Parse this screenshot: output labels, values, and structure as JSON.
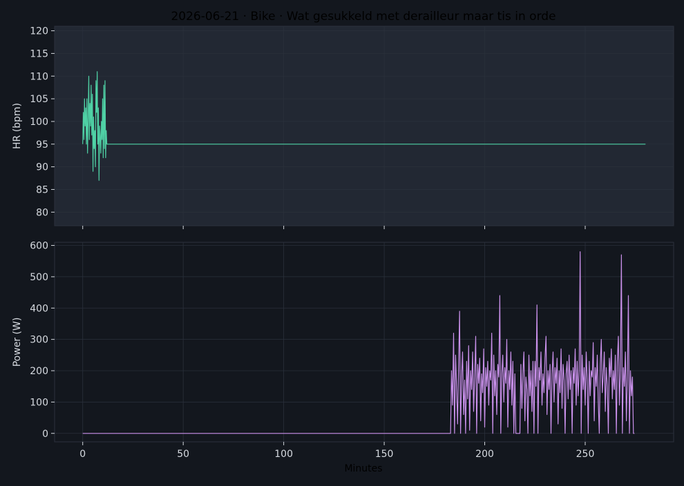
{
  "colors": {
    "background": "#13171e",
    "panel_top": "#222833",
    "panel_bottom": "#13171e",
    "panel_border": "#2c323d",
    "grid": "#2a303b",
    "text": "#d6dae0",
    "hr_line": "#4fd1a5",
    "power_line": "#c990ea"
  },
  "chart_data": {
    "type": "line",
    "title": "2026-06-21 · Bike · Wat gesukkeld met derailleur maar tis in orde",
    "xlabel": "Minutes",
    "x_ticks": [
      0,
      50,
      100,
      150,
      200,
      250
    ],
    "xlim": [
      -14,
      294
    ],
    "grid": true,
    "panels": [
      {
        "name": "hr",
        "ylabel": "HR (bpm)",
        "ylim": [
          77,
          121
        ],
        "y_ticks": [
          80,
          85,
          90,
          95,
          100,
          105,
          110,
          115,
          120
        ],
        "series": [
          {
            "x": [
              0,
              0.3,
              0.6,
              0.9,
              1.2,
              1.5,
              1.8,
              2.1,
              2.4,
              2.7,
              3.0,
              3.3,
              3.6,
              3.9,
              4.2,
              4.5,
              4.8,
              5.1,
              5.4,
              5.7,
              6.0,
              6.3,
              6.6,
              6.9,
              7.2,
              7.5,
              7.8,
              8.1,
              8.4,
              8.7,
              9.0,
              9.3,
              9.6,
              9.9,
              10.2,
              10.5,
              10.8,
              11.1,
              11.4,
              11.7,
              12.0,
              12.3,
              12.6,
              13,
              280
            ],
            "y": [
              95,
              102,
              96,
              105,
              99,
              103,
              95,
              105,
              93,
              101,
              110,
              96,
              104,
              99,
              108,
              97,
              106,
              89,
              101,
              94,
              98,
              90,
              109,
              102,
              111,
              95,
              103,
              87,
              99,
              97,
              93,
              100,
              96,
              105,
              92,
              108,
              94,
              109,
              92,
              98,
              95,
              95,
              95,
              95,
              95
            ]
          }
        ]
      },
      {
        "name": "power",
        "ylabel": "Power (W)",
        "ylim": [
          -27,
          610
        ],
        "y_ticks": [
          0,
          100,
          200,
          300,
          400,
          500,
          600
        ],
        "series": [
          {
            "x": [
              0,
              183,
              183.5,
              184,
              184.5,
              185,
              185.5,
              186,
              186.5,
              187,
              187.5,
              188,
              188.5,
              189,
              189.5,
              190,
              190.5,
              191,
              191.5,
              192,
              192.5,
              193,
              193.5,
              194,
              194.5,
              195,
              195.5,
              196,
              196.5,
              197,
              197.5,
              198,
              198.5,
              199,
              199.5,
              200,
              200.5,
              201,
              201.5,
              202,
              202.5,
              203,
              203.5,
              204,
              204.5,
              205,
              205.5,
              206,
              206.5,
              207,
              207.5,
              208,
              208.5,
              209,
              209.5,
              210,
              210.5,
              211,
              211.5,
              212,
              212.5,
              213,
              213.5,
              214,
              214.5,
              215,
              215.5,
              216,
              216.5,
              217,
              217.5,
              218,
              218.5,
              219,
              219.5,
              220,
              220.5,
              221,
              221.5,
              222,
              222.5,
              223,
              223.5,
              224,
              224.5,
              225,
              225.5,
              226,
              226.5,
              227,
              227.5,
              228,
              228.5,
              229,
              229.5,
              230,
              230.5,
              231,
              231.5,
              232,
              232.5,
              233,
              233.5,
              234,
              234.5,
              235,
              235.5,
              236,
              236.5,
              237,
              237.5,
              238,
              238.5,
              239,
              239.5,
              240,
              240.5,
              241,
              241.5,
              242,
              242.5,
              243,
              243.5,
              244,
              244.5,
              245,
              245.5,
              246,
              246.5,
              247,
              247.5,
              248,
              248.5,
              249,
              249.5,
              250,
              250.5,
              251,
              251.5,
              252,
              252.5,
              253,
              253.5,
              254,
              254.5,
              255,
              255.5,
              256,
              256.5,
              257,
              257.5,
              258,
              258.5,
              259,
              259.5,
              260,
              260.5,
              261,
              261.5,
              262,
              262.5,
              263,
              263.5,
              264,
              264.5,
              265,
              265.5,
              266,
              266.5,
              267,
              267.5,
              268,
              268.5,
              269,
              269.5,
              270,
              270.5,
              271,
              271.5,
              272,
              272.5,
              273,
              273.5,
              274,
              274.5,
              275,
              275.5,
              276,
              276.5,
              277,
              277.5,
              278,
              278.5,
              279,
              280
            ],
            "y": [
              0,
              0,
              200,
              90,
              320,
              0,
              250,
              150,
              30,
              210,
              390,
              0,
              180,
              260,
              60,
              170,
              0,
              230,
              110,
              280,
              10,
              200,
              140,
              260,
              70,
              180,
              310,
              0,
              220,
              160,
              240,
              40,
              190,
              130,
              270,
              20,
              210,
              150,
              230,
              90,
              200,
              170,
              320,
              0,
              250,
              120,
              200,
              60,
              220,
              180,
              440,
              0,
              190,
              250,
              100,
              210,
              160,
              300,
              20,
              200,
              140,
              260,
              90,
              230,
              0,
              190,
              0,
              0,
              0,
              0,
              0,
              220,
              80,
              190,
              260,
              40,
              180,
              140,
              0,
              250,
              120,
              200,
              70,
              230,
              0,
              230,
              150,
              410,
              0,
              210,
              170,
              260,
              90,
              190,
              130,
              240,
              310,
              60,
              200,
              140,
              220,
              0,
              190,
              260,
              100,
              210,
              160,
              240,
              30,
              200,
              130,
              270,
              80,
              220,
              170,
              0,
              190,
              230,
              110,
              250,
              140,
              200,
              0,
              210,
              160,
              270,
              90,
              230,
              120,
              200,
              580,
              0,
              250,
              140,
              210,
              90,
              260,
              170,
              0,
              230,
              120,
              200,
              180,
              290,
              40,
              210,
              150,
              250,
              100,
              0,
              220,
              300,
              130,
              190,
              260,
              70,
              210,
              150,
              0,
              240,
              180,
              270,
              110,
              200,
              140,
              250,
              0,
              230,
              310,
              90,
              200,
              570,
              0,
              210,
              150,
              260,
              40,
              190,
              440,
              0,
              200,
              120,
              180,
              0,
              0
            ]
          }
        ]
      }
    ]
  }
}
